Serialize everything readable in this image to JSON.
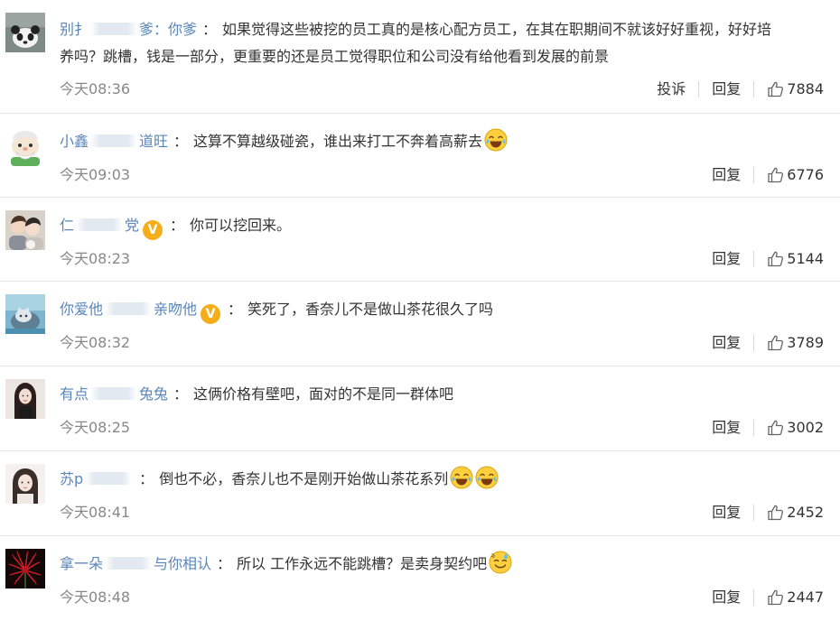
{
  "comments": [
    {
      "user": "别扌",
      "user_suffix": "爹：你爹",
      "text_line1": "如果觉得这些被挖的员工真的是核心配方员工，在其在职期间不就该好好重视，好好培",
      "text_line2": "养吗？跳槽，钱是一部分，更重要的还是员工觉得职位和公司没有给他看到发展的前景",
      "time": "今天08:36",
      "report": "投诉",
      "reply": "回复",
      "likes": "7884",
      "avatar": "panda-avatar"
    },
    {
      "user": "小鑫",
      "user_suffix": "道旺",
      "text": "这算不算越级碰瓷，谁出来打工不奔着高薪去",
      "emoji": "laugh-cry-emoji",
      "time": "今天09:03",
      "reply": "回复",
      "likes": "6776",
      "avatar": "cartoon-old-man-avatar"
    },
    {
      "user": "仁",
      "user_suffix": "党",
      "verified": "V",
      "text": "你可以挖回来。",
      "time": "今天08:23",
      "reply": "回复",
      "likes": "5144",
      "avatar": "couple-photo-avatar"
    },
    {
      "user": "你爱他",
      "user_suffix": "亲吻他",
      "verified": "V",
      "text": "笑死了，香奈儿不是做山茶花很久了吗",
      "time": "今天08:32",
      "reply": "回复",
      "likes": "3789",
      "avatar": "cat-photo-avatar"
    },
    {
      "user": "有点",
      "user_suffix": "兔兔",
      "text": "这俩价格有壁吧，面对的不是同一群体吧",
      "time": "今天08:25",
      "reply": "回复",
      "likes": "3002",
      "avatar": "woman-photo-avatar"
    },
    {
      "user": "苏p",
      "user_suffix": "",
      "text": "倒也不必，香奈儿也不是刚开始做山茶花系列",
      "emoji": "laugh-cry-emoji",
      "emoji2": "laugh-cry-emoji",
      "time": "今天08:41",
      "reply": "回复",
      "likes": "2452",
      "avatar": "girl-photo-avatar"
    },
    {
      "user": "拿一朵",
      "user_suffix": "与你相认",
      "text": "所以 工作永远不能跳槽？是卖身契约吧",
      "emoji": "sweat-smile-emoji",
      "time": "今天08:48",
      "reply": "回复",
      "likes": "2447",
      "avatar": "red-flower-avatar"
    }
  ],
  "colors": {
    "username": "#5a86b8",
    "text": "#333333",
    "time": "#888888",
    "verified_badge": "#f6ad1a",
    "divider": "#e6e6e6"
  }
}
